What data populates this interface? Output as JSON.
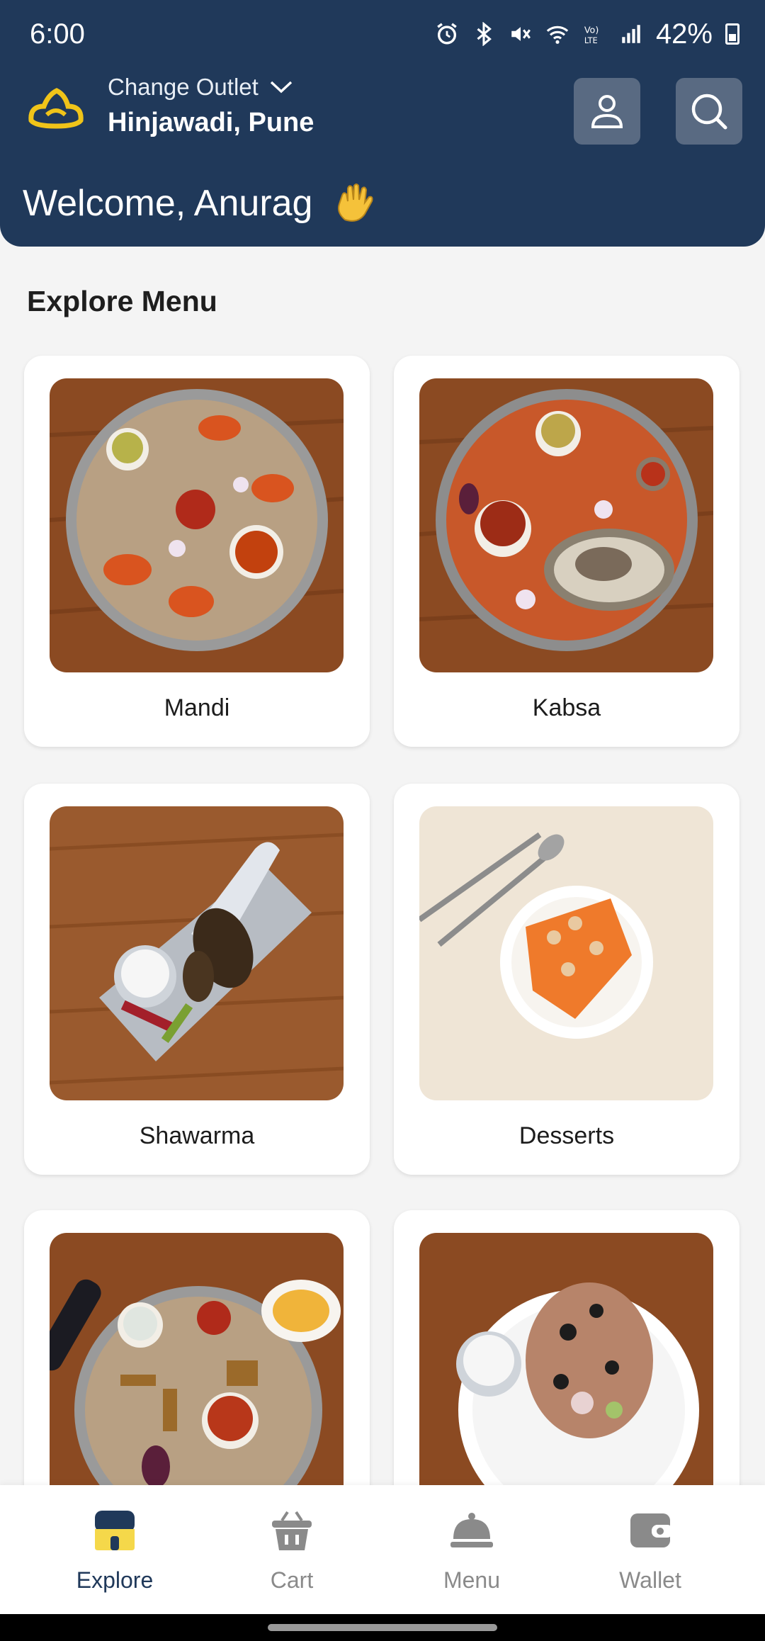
{
  "status_bar": {
    "time": "6:00",
    "battery": "42%",
    "icons": [
      "alarm-icon",
      "bluetooth-icon",
      "mute-icon",
      "wifi-icon",
      "volte-icon",
      "signal-icon",
      "battery-icon"
    ]
  },
  "header": {
    "change_outlet": "Change Outlet",
    "location": "Hinjawadi, Pune",
    "welcome": "Welcome, Anurag",
    "wave_emoji": "👋",
    "colors": {
      "background": "#20395a",
      "button": "#596a82",
      "logo": "#f0c419"
    }
  },
  "explore": {
    "title": "Explore Menu",
    "items": [
      {
        "label": "Mandi"
      },
      {
        "label": "Kabsa"
      },
      {
        "label": "Shawarma"
      },
      {
        "label": "Desserts"
      },
      {
        "label": ""
      },
      {
        "label": ""
      }
    ]
  },
  "bottom_nav": {
    "items": [
      {
        "label": "Explore",
        "icon": "store-icon",
        "active": true
      },
      {
        "label": "Cart",
        "icon": "basket-icon",
        "active": false
      },
      {
        "label": "Menu",
        "icon": "cloche-icon",
        "active": false
      },
      {
        "label": "Wallet",
        "icon": "wallet-icon",
        "active": false
      }
    ]
  }
}
